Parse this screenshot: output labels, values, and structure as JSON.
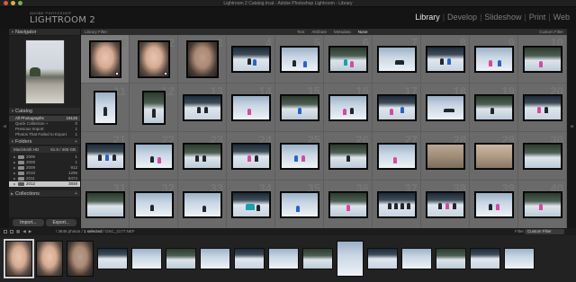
{
  "window": {
    "title": "Lightroom 2 Catalog.lrcat - Adobe Photoshop Lightroom - Library"
  },
  "identity": {
    "small": "ADOBE PHOTOSHOP",
    "big": "LIGHTROOM 2"
  },
  "modules": [
    "Library",
    "Develop",
    "Slideshow",
    "Print",
    "Web"
  ],
  "navigator": {
    "label": "Navigator"
  },
  "catalog": {
    "label": "Catalog",
    "items": [
      {
        "label": "All Photographs",
        "count": "18125"
      },
      {
        "label": "Quick Collection +",
        "count": "0"
      },
      {
        "label": "Previous Import",
        "count": "1"
      },
      {
        "label": "Photos That Failed to Export",
        "count": "1"
      }
    ]
  },
  "folders": {
    "label": "Folders",
    "volume": {
      "name": "Macintosh HD",
      "info": "81.6 / 465 GB"
    },
    "items": [
      {
        "label": "2006",
        "count": "1"
      },
      {
        "label": "2008",
        "count": "1"
      },
      {
        "label": "2009",
        "count": "912"
      },
      {
        "label": "2010",
        "count": "1296"
      },
      {
        "label": "2011",
        "count": "8474"
      },
      {
        "label": "2012",
        "count": "3848"
      }
    ]
  },
  "collections": {
    "label": "Collections"
  },
  "left_buttons": {
    "import": "Import...",
    "export": "Export..."
  },
  "filter_bar": {
    "label": "Library Filter :",
    "tabs": [
      "Text",
      "Attribute",
      "Metadata",
      "None"
    ],
    "active_tab": "None",
    "custom": "Custom Filter"
  },
  "grid": {
    "numbers": [
      "1",
      "2",
      "3",
      "4",
      "5",
      "6",
      "7",
      "8",
      "9",
      "10",
      "11",
      "12",
      "13",
      "14",
      "15",
      "16",
      "17",
      "18",
      "19",
      "20",
      "21",
      "22",
      "23",
      "24",
      "25",
      "26",
      "27",
      "28",
      "29",
      "30",
      "31",
      "32",
      "33",
      "34",
      "35",
      "36",
      "37",
      "38",
      "39",
      "40"
    ]
  },
  "filmstrip": {
    "path_prefix": "/ 3848 photos / ",
    "selected": "1 selected",
    "file": " / DSC_2177.NEF",
    "filter_label": "Filter :",
    "filter_value": "Custom Filter"
  }
}
